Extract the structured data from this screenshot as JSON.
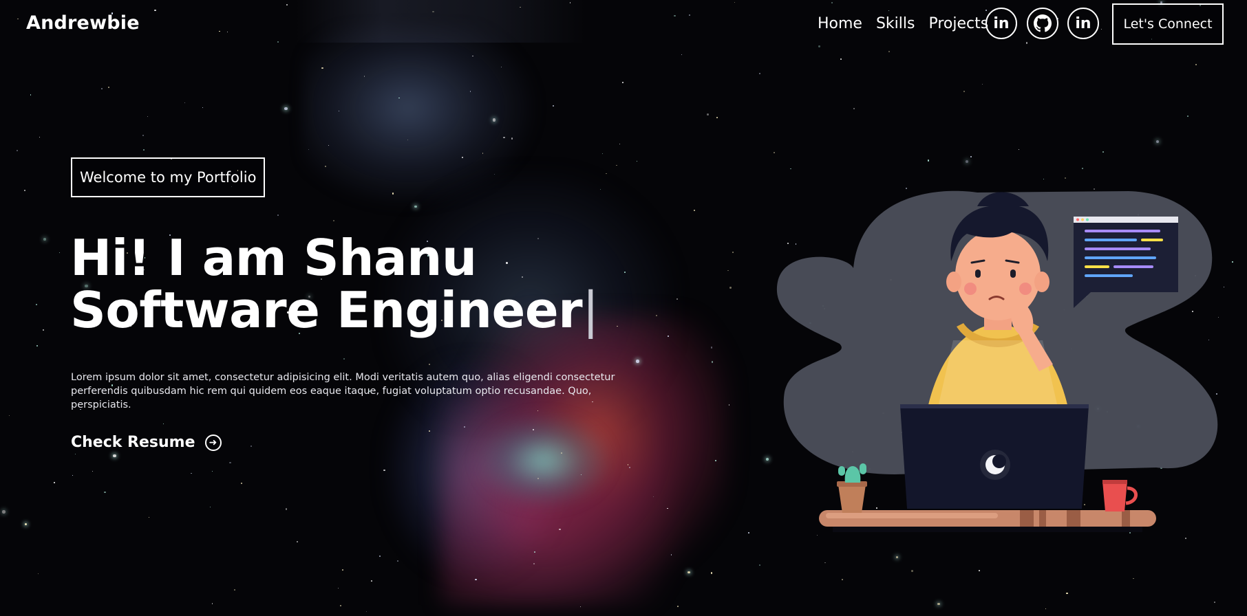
{
  "nav": {
    "brand": "Andrewbie",
    "links": [
      "Home",
      "Skills",
      "Projects"
    ],
    "social_icons": [
      "linkedin-icon",
      "github-icon",
      "linkedin-icon"
    ],
    "connect_label": "Let's Connect"
  },
  "hero": {
    "tagline": "Welcome to my Portfolio",
    "title_line1": "Hi! I am Shanu",
    "title_line2": "Software Engineer",
    "cursor": "|",
    "description": "Lorem ipsum dolor sit amet, consectetur adipisicing elit. Modi veritatis autem quo, alias eligendi consectetur perferendis quibusdam hic rem qui quidem eos eaque itaque, fugiat voluptatum optio recusandae. Quo, perspiciatis.",
    "resume_label": "Check Resume",
    "resume_icon": "arrow-right-circle-icon"
  },
  "colors": {
    "background": "#050508",
    "text": "#ffffff",
    "cloud": "#4b4e5a",
    "hoodie": "#f1c24f",
    "laptop": "#13162b",
    "desk": "#c8876a"
  }
}
